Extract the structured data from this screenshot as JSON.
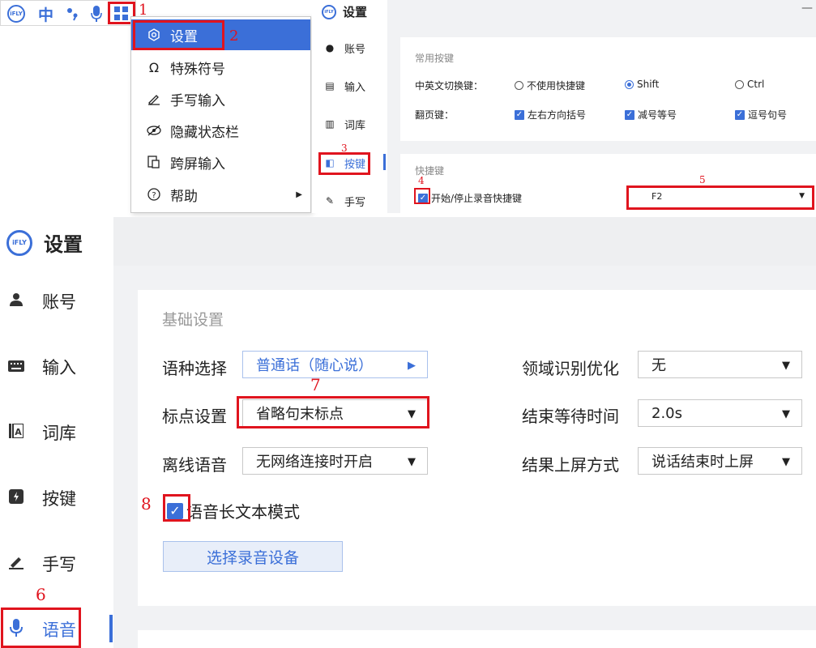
{
  "colors": {
    "accent": "#3b6fd8",
    "annotation": "#e0141e",
    "panel_bg": "#f1f2f4"
  },
  "toolbar": {
    "logo": "iFLY",
    "lang_label": "中",
    "icons": [
      "punctuation-icon",
      "microphone-icon",
      "grid-menu-icon"
    ]
  },
  "context_menu": {
    "items": [
      {
        "label": "设置",
        "icon": "settings-icon"
      },
      {
        "label": "特殊符号",
        "icon": "omega-icon"
      },
      {
        "label": "手写输入",
        "icon": "pen-icon"
      },
      {
        "label": "隐藏状态栏",
        "icon": "hide-icon"
      },
      {
        "label": "跨屏输入",
        "icon": "cross-screen-icon"
      },
      {
        "label": "帮助",
        "icon": "help-icon"
      }
    ]
  },
  "top_settings": {
    "title": "设置",
    "logo": "iFLY",
    "nav": [
      {
        "label": "账号",
        "icon": "user-icon"
      },
      {
        "label": "输入",
        "icon": "keyboard-icon"
      },
      {
        "label": "词库",
        "icon": "lexicon-icon"
      },
      {
        "label": "按键",
        "icon": "key-icon"
      },
      {
        "label": "手写",
        "icon": "pen-icon"
      }
    ],
    "common_keys": {
      "section_title": "常用按键",
      "switch_label": "中英文切换键：",
      "switch_options": [
        "不使用快捷键",
        "Shift",
        "Ctrl"
      ],
      "switch_selected": "Shift",
      "page_label": "翻页键：",
      "page_options": [
        "左右方向括号",
        "减号等号",
        "逗号句号"
      ]
    },
    "shortcut": {
      "section_title": "快捷键",
      "record_label": "开始/停止录音快捷键",
      "record_key": "F2"
    }
  },
  "bottom_settings": {
    "title": "设置",
    "logo": "iFLY",
    "nav": [
      {
        "label": "账号",
        "icon": "user-icon"
      },
      {
        "label": "输入",
        "icon": "keyboard-icon"
      },
      {
        "label": "词库",
        "icon": "lexicon-icon"
      },
      {
        "label": "按键",
        "icon": "key-icon"
      },
      {
        "label": "手写",
        "icon": "pen-icon"
      },
      {
        "label": "语音",
        "icon": "microphone-icon"
      }
    ],
    "basic": {
      "section_title": "基础设置",
      "language_label": "语种选择",
      "language_value": "普通话（随心说）",
      "punct_label": "标点设置",
      "punct_value": "省略句末标点",
      "offline_label": "离线语音",
      "offline_value": "无网络连接时开启",
      "domain_label": "领域识别优化",
      "domain_value": "无",
      "wait_label": "结束等待时间",
      "wait_value": "2.0s",
      "output_label": "结果上屏方式",
      "output_value": "说话结束时上屏",
      "longtext_label": "语音长文本模式",
      "device_button": "选择录音设备"
    }
  },
  "annotations": [
    "1",
    "2",
    "3",
    "4",
    "5",
    "6",
    "7",
    "8"
  ]
}
